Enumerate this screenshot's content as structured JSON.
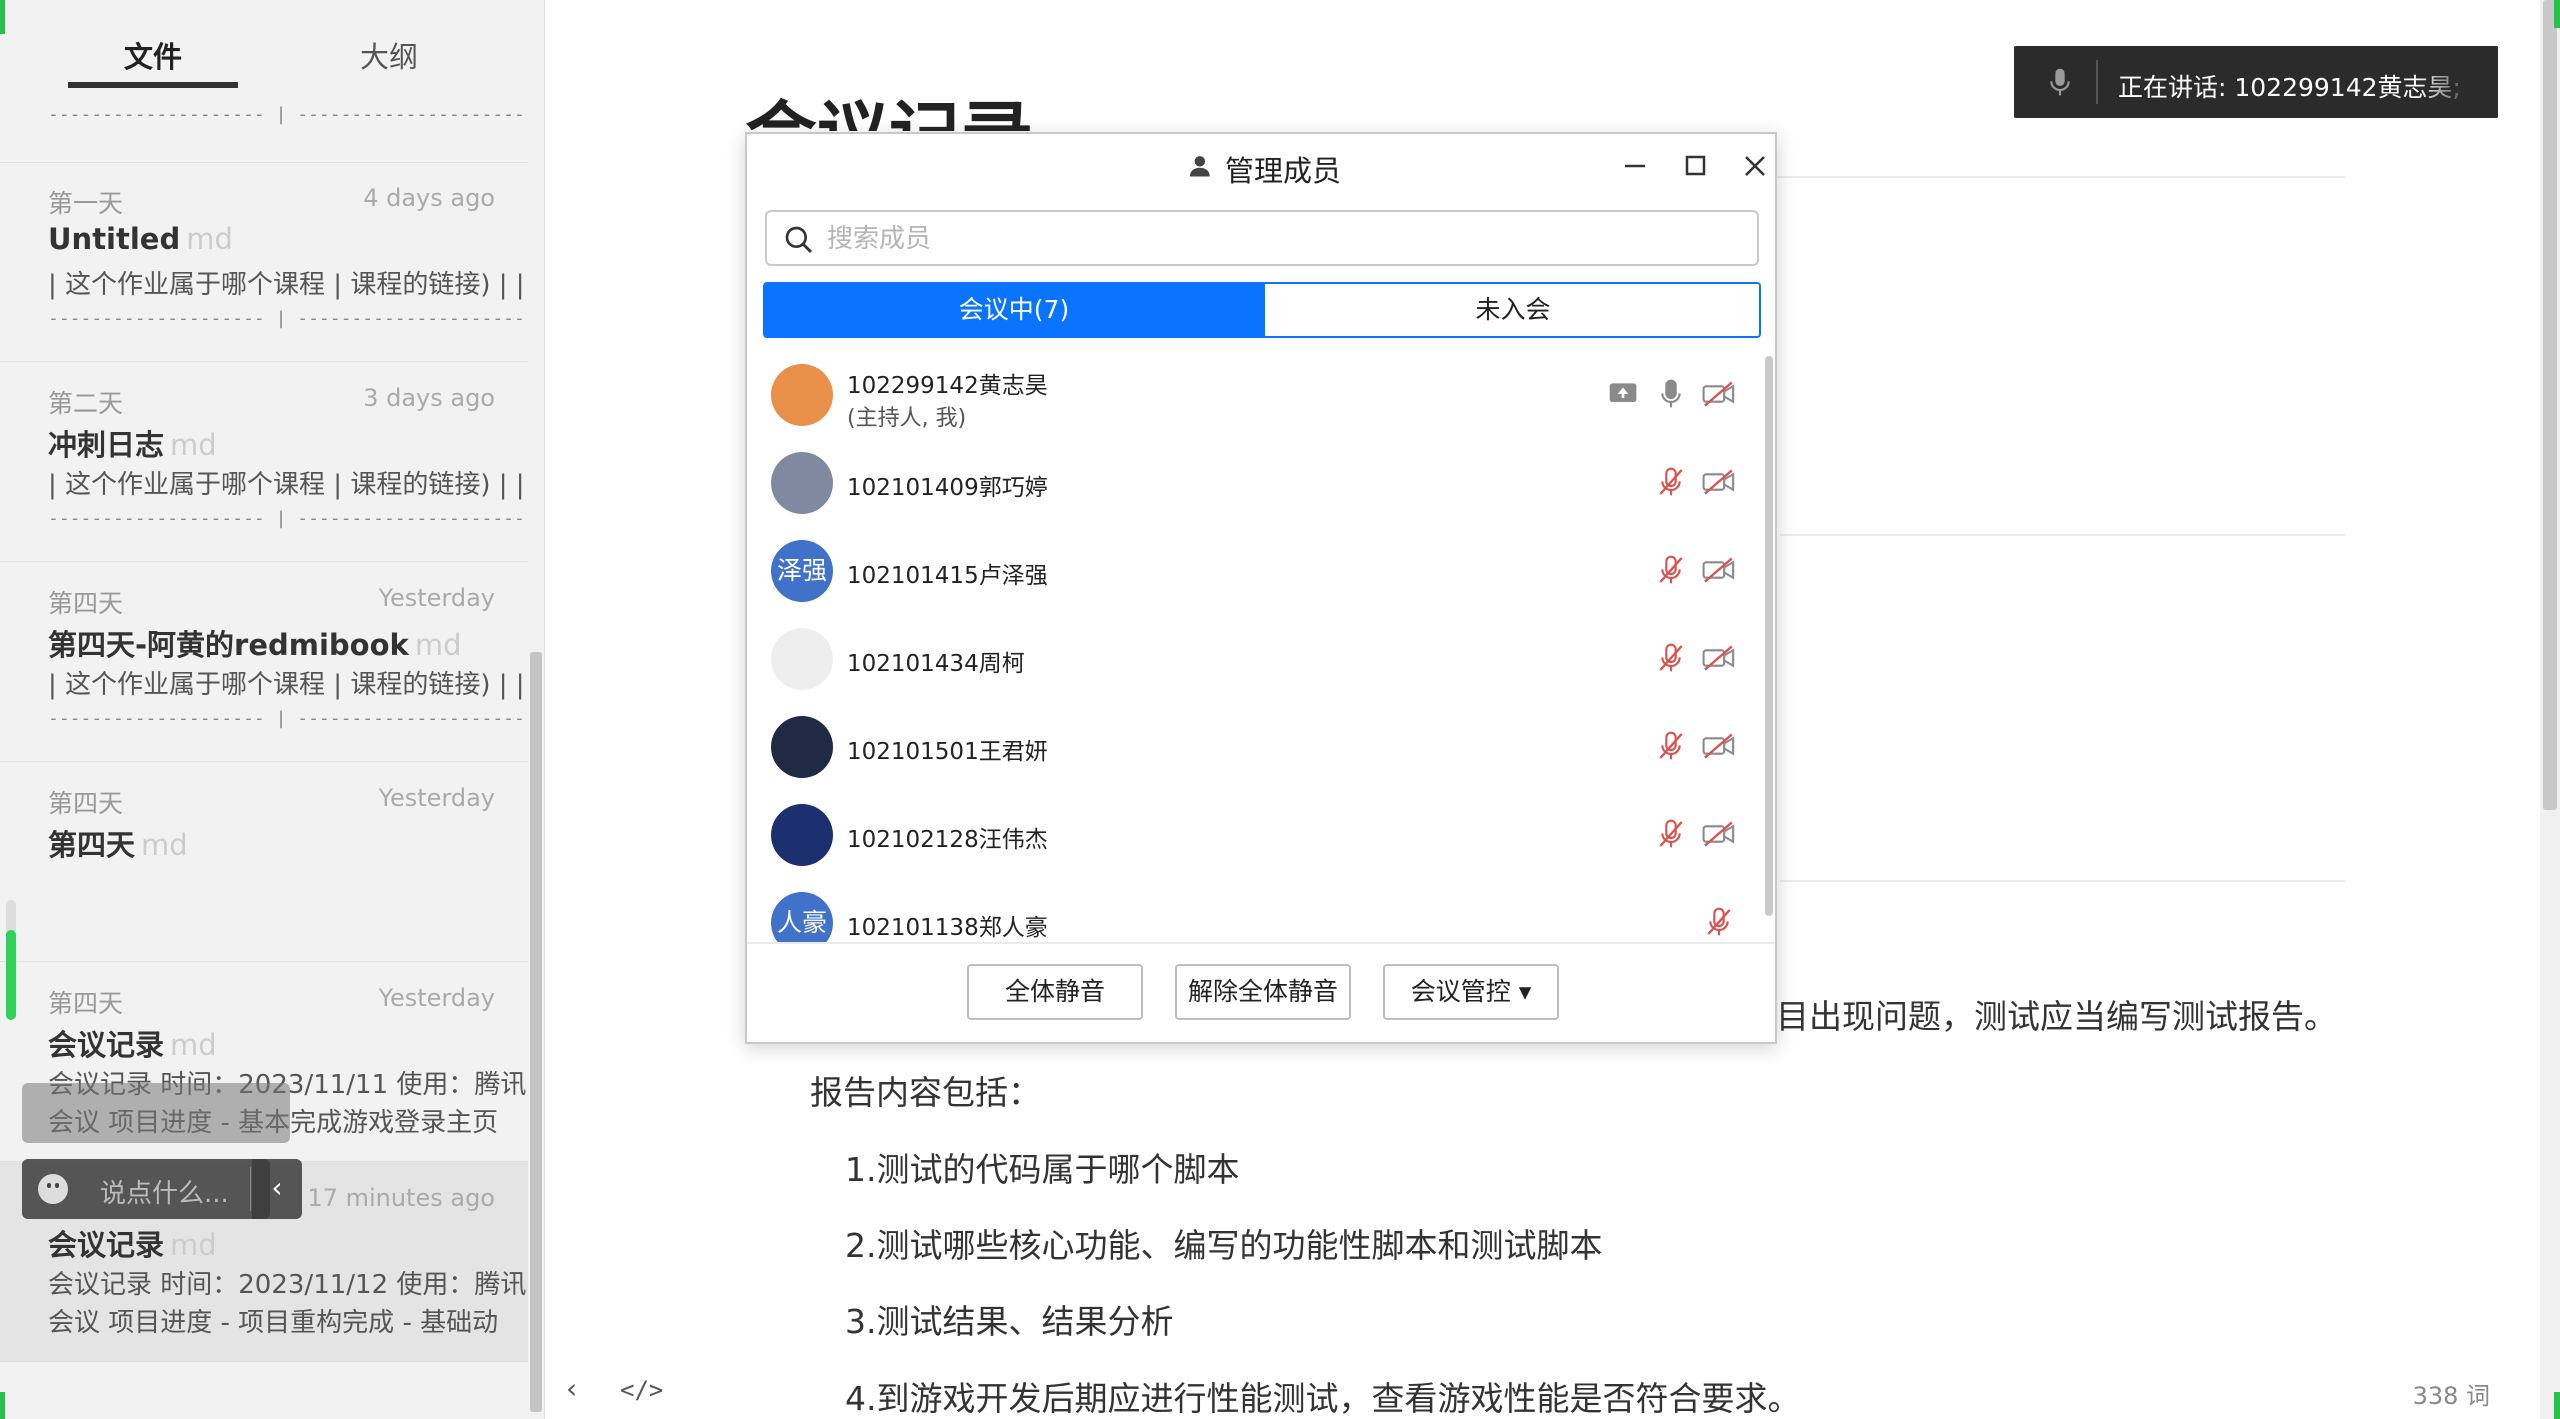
{
  "sidebar": {
    "tabs": {
      "files": "文件",
      "outline": "大纲"
    },
    "divider_text": "-------------------- | ---------------------",
    "files": [
      {
        "meta": "第一天",
        "time": "4 days ago",
        "title": "Untitled",
        "ext": "md",
        "line1": "| 这个作业属于哪个课程 | 课程的链接) | |",
        "line2": "-------------------- | ---------------------"
      },
      {
        "meta": "第二天",
        "time": "3 days ago",
        "title": "冲刺日志",
        "ext": "md",
        "line1": "| 这个作业属于哪个课程 | 课程的链接) | |",
        "line2": "-------------------- | ---------------------"
      },
      {
        "meta": "第四天",
        "time": "Yesterday",
        "title": "第四天-阿黄的redmibook",
        "ext": "md",
        "line1": "| 这个作业属于哪个课程 | 课程的链接) | |",
        "line2": "-------------------- | ---------------------"
      },
      {
        "meta": "第四天",
        "time": "Yesterday",
        "title": "第四天",
        "ext": "md",
        "line1": "",
        "line2": ""
      },
      {
        "meta": "第四天",
        "time": "Yesterday",
        "title": "会议记录",
        "ext": "md",
        "line1": "会议记录 时间：2023/11/11 使用：腾讯",
        "line2": "会议 项目进度 - 基本完成游戏登录主页"
      },
      {
        "meta": "",
        "time": "17 minutes ago",
        "title": "会议记录",
        "ext": "md",
        "line1": "会议记录 时间：2023/11/12 使用：腾讯",
        "line2": "会议 项目进度 - 项目重构完成 - 基础动"
      }
    ]
  },
  "chat": {
    "placeholder": "说点什么..."
  },
  "editor": {
    "title": "会议记录",
    "visible_fragment": "目出现问题，测试应当编写测试报告。",
    "report_heading": "报告内容包括：",
    "items": [
      "1.测试的代码属于哪个脚本",
      "2.测试哪些核心功能、编写的功能性脚本和测试脚本",
      "3.测试结果、结果分析",
      "4.到游戏开发后期应进行性能测试，查看游戏性能是否符合要求。"
    ],
    "word_count": "338 词"
  },
  "speaking_banner": {
    "label": "正在讲话:   102299142黄志昊;"
  },
  "member_dialog": {
    "title": "管理成员",
    "search_placeholder": "搜索成员",
    "tabs": {
      "in_meeting": "会议中(7)",
      "not_joined": "未入会"
    },
    "members": [
      {
        "name": "102299142黄志昊",
        "sub": "(主持人, 我)",
        "avatar_text": "",
        "avatar_color": "#e8904a",
        "mic_muted": false,
        "cam_off": true,
        "screen_share": true
      },
      {
        "name": "102101409郭巧婷",
        "sub": "",
        "avatar_text": "",
        "avatar_color": "#7f8aa0",
        "mic_muted": true,
        "cam_off": true,
        "screen_share": false
      },
      {
        "name": "102101415卢泽强",
        "sub": "",
        "avatar_text": "泽强",
        "avatar_color": "#3f72c8",
        "mic_muted": true,
        "cam_off": true,
        "screen_share": false
      },
      {
        "name": "102101434周柯",
        "sub": "",
        "avatar_text": "",
        "avatar_color": "#eeeeee",
        "mic_muted": true,
        "cam_off": true,
        "screen_share": false
      },
      {
        "name": "102101501王君妍",
        "sub": "",
        "avatar_text": "",
        "avatar_color": "#1f2a44",
        "mic_muted": true,
        "cam_off": true,
        "screen_share": false
      },
      {
        "name": "102102128汪伟杰",
        "sub": "",
        "avatar_text": "",
        "avatar_color": "#1c2f6e",
        "mic_muted": true,
        "cam_off": true,
        "screen_share": false
      },
      {
        "name": "102101138郑人豪",
        "sub": "",
        "avatar_text": "人豪",
        "avatar_color": "#3f72c8",
        "mic_muted": true,
        "cam_off": false,
        "screen_share": false
      }
    ],
    "buttons": {
      "mute_all": "全体静音",
      "unmute_all": "解除全体静音",
      "controls": "会议管控 ▾"
    }
  },
  "colors": {
    "accent": "#0a74ff",
    "muted_icon": "#d9534f",
    "green": "#27c24c"
  }
}
